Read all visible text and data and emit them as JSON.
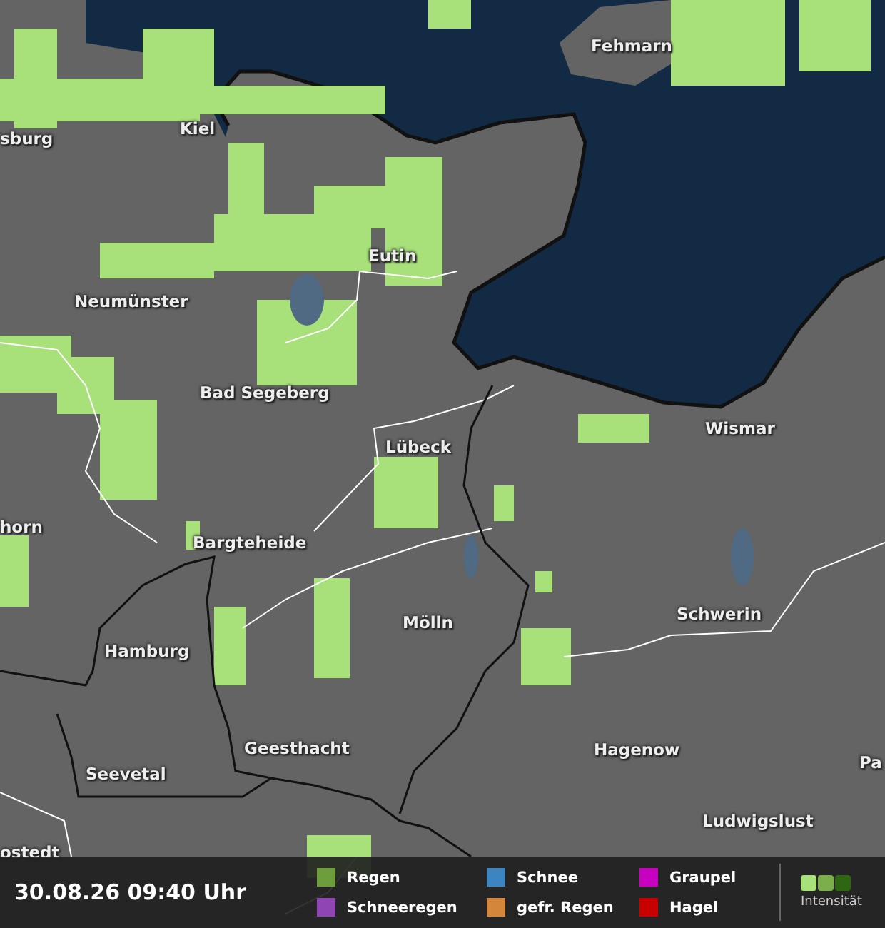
{
  "map": {
    "cities": [
      {
        "name": "sburg"
      },
      {
        "name": "Kiel"
      },
      {
        "name": "Fehmarn"
      },
      {
        "name": "Eutin"
      },
      {
        "name": "Neumünster"
      },
      {
        "name": "Bad Segeberg"
      },
      {
        "name": "Wismar"
      },
      {
        "name": "Lübeck"
      },
      {
        "name": "horn"
      },
      {
        "name": "Bargteheide"
      },
      {
        "name": "Mölln"
      },
      {
        "name": "Schwerin"
      },
      {
        "name": "Hamburg"
      },
      {
        "name": "Geesthacht"
      },
      {
        "name": "Hagenow"
      },
      {
        "name": "Seevetal"
      },
      {
        "name": "Pa"
      },
      {
        "name": "Ludwigslust"
      },
      {
        "name": "ostedt"
      }
    ]
  },
  "legend": {
    "timestamp": "30.08.26 09:40 Uhr",
    "items": [
      {
        "label": "Regen",
        "color": "#6e9e3c"
      },
      {
        "label": "Schneeregen",
        "color": "#9045b5"
      },
      {
        "label": "Schnee",
        "color": "#3d85c0"
      },
      {
        "label": "gefr. Regen",
        "color": "#d4863a"
      },
      {
        "label": "Graupel",
        "color": "#c800c0"
      },
      {
        "label": "Hagel",
        "color": "#c80000"
      }
    ],
    "intensity": {
      "label": "Intensität",
      "swatches": [
        {
          "color": "#a8e07a"
        },
        {
          "color": "#7cae4c"
        },
        {
          "color": "#2f6612"
        }
      ]
    }
  }
}
